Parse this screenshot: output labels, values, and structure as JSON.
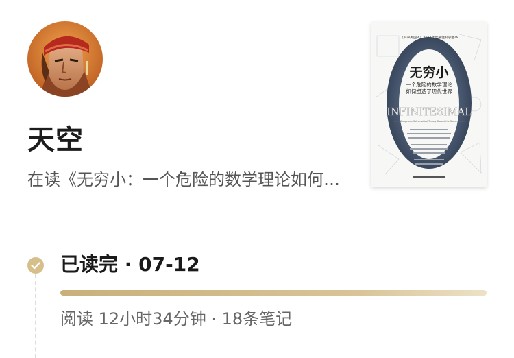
{
  "profile": {
    "username": "天空",
    "reading_status": "在读《无穷小：一个危险的数学理论如何塑造了现代世界》"
  },
  "book": {
    "cover_tagline": "《科学美国人》2014年度最佳科学图书",
    "cover_title": "无穷小",
    "cover_subtitle_1": "一个危险的数学理论",
    "cover_subtitle_2": "如何塑造了现代世界",
    "cover_english": "INFINITESIMAL",
    "cover_english_sub": "How a Dangerous Mathematical Theory Shaped the Modern World"
  },
  "timeline": {
    "title": "已读完 · 07-12",
    "progress": 1.0,
    "stats": "阅读 12小时34分钟 · 18条笔记"
  },
  "colors": {
    "accent_gold": "#c9b07a",
    "check_circle": "#d6bf8a",
    "cover_stone": "#4a5a72"
  },
  "icons": {
    "status": "check-circle-icon"
  }
}
